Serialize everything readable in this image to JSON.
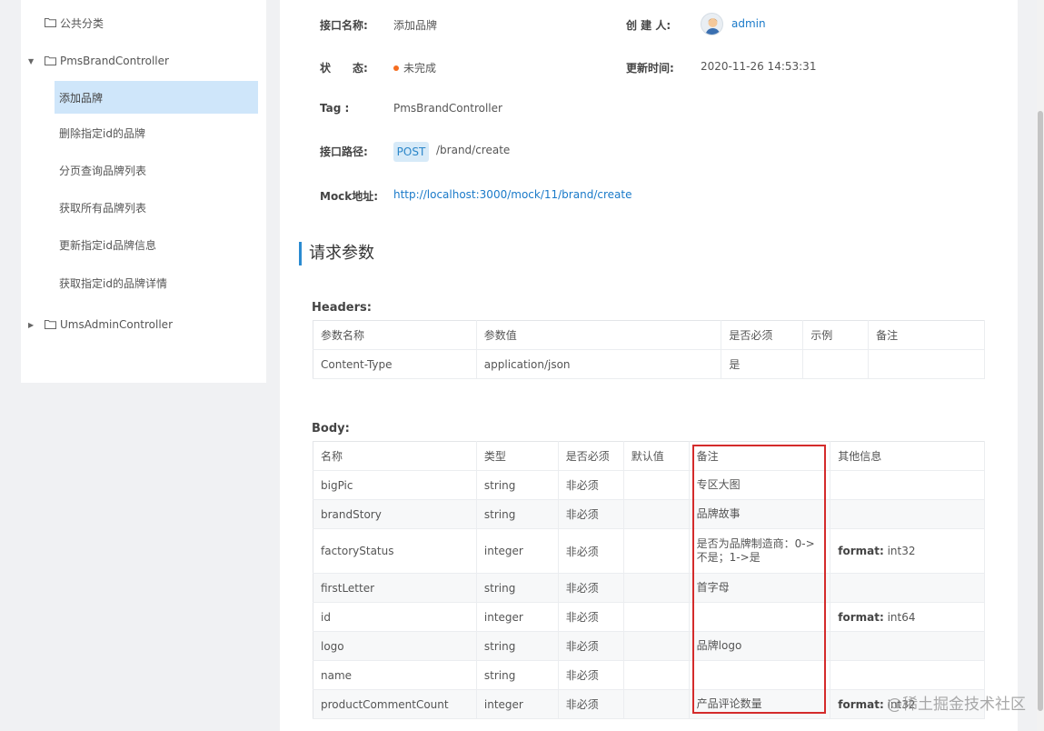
{
  "sidebar": {
    "items": [
      {
        "label": "公共分类",
        "type": "folder",
        "expanded": false
      },
      {
        "label": "PmsBrandController",
        "type": "folder",
        "expanded": true
      },
      {
        "label": "添加品牌",
        "type": "api",
        "active": true
      },
      {
        "label": "删除指定id的品牌",
        "type": "api"
      },
      {
        "label": "分页查询品牌列表",
        "type": "api"
      },
      {
        "label": "获取所有品牌列表",
        "type": "api"
      },
      {
        "label": "更新指定id品牌信息",
        "type": "api"
      },
      {
        "label": "获取指定id的品牌详情",
        "type": "api"
      },
      {
        "label": "UmsAdminController",
        "type": "folder",
        "expanded": false
      }
    ]
  },
  "info": {
    "name_label": "接口名称:",
    "name_value": "添加品牌",
    "creator_label": "创 建 人:",
    "creator_value": "admin",
    "status_label": "状　　态:",
    "status_value": "未完成",
    "updated_label": "更新时间:",
    "updated_value": "2020-11-26 14:53:31",
    "tag_label": "Tag :",
    "tag_value": "PmsBrandController",
    "path_label": "接口路径:",
    "method": "POST",
    "path_value": "/brand/create",
    "mock_label": "Mock地址:",
    "mock_value": "http://localhost:3000/mock/11/brand/create"
  },
  "request": {
    "title": "请求参数",
    "headers_title": "Headers:",
    "headers_columns": [
      "参数名称",
      "参数值",
      "是否必须",
      "示例",
      "备注"
    ],
    "headers_rows": [
      [
        "Content-Type",
        "application/json",
        "是",
        "",
        ""
      ]
    ],
    "body_title": "Body:",
    "body_columns": [
      "名称",
      "类型",
      "是否必须",
      "默认值",
      "备注",
      "其他信息"
    ],
    "body_rows": [
      {
        "name": "bigPic",
        "type": "string",
        "required": "非必须",
        "default": "",
        "note": "专区大图",
        "other_label": "",
        "other_value": ""
      },
      {
        "name": "brandStory",
        "type": "string",
        "required": "非必须",
        "default": "",
        "note": "品牌故事",
        "other_label": "",
        "other_value": ""
      },
      {
        "name": "factoryStatus",
        "type": "integer",
        "required": "非必须",
        "default": "",
        "note": "是否为品牌制造商：0->不是；1->是",
        "other_label": "format:",
        "other_value": "int32"
      },
      {
        "name": "firstLetter",
        "type": "string",
        "required": "非必须",
        "default": "",
        "note": "首字母",
        "other_label": "",
        "other_value": ""
      },
      {
        "name": "id",
        "type": "integer",
        "required": "非必须",
        "default": "",
        "note": "",
        "other_label": "format:",
        "other_value": "int64"
      },
      {
        "name": "logo",
        "type": "string",
        "required": "非必须",
        "default": "",
        "note": "品牌logo",
        "other_label": "",
        "other_value": ""
      },
      {
        "name": "name",
        "type": "string",
        "required": "非必须",
        "default": "",
        "note": "",
        "other_label": "",
        "other_value": ""
      },
      {
        "name": "productCommentCount",
        "type": "integer",
        "required": "非必须",
        "default": "",
        "note": "产品评论数量",
        "other_label": "format:",
        "other_value": "int32"
      }
    ]
  },
  "watermark": "@稀土掘金技术社区",
  "colors": {
    "accent": "#2a8bd1",
    "link": "#1a7ac9",
    "status_dot": "#f56c1f",
    "highlight": "#d42b2b",
    "active_bg": "#cfe6fa"
  }
}
